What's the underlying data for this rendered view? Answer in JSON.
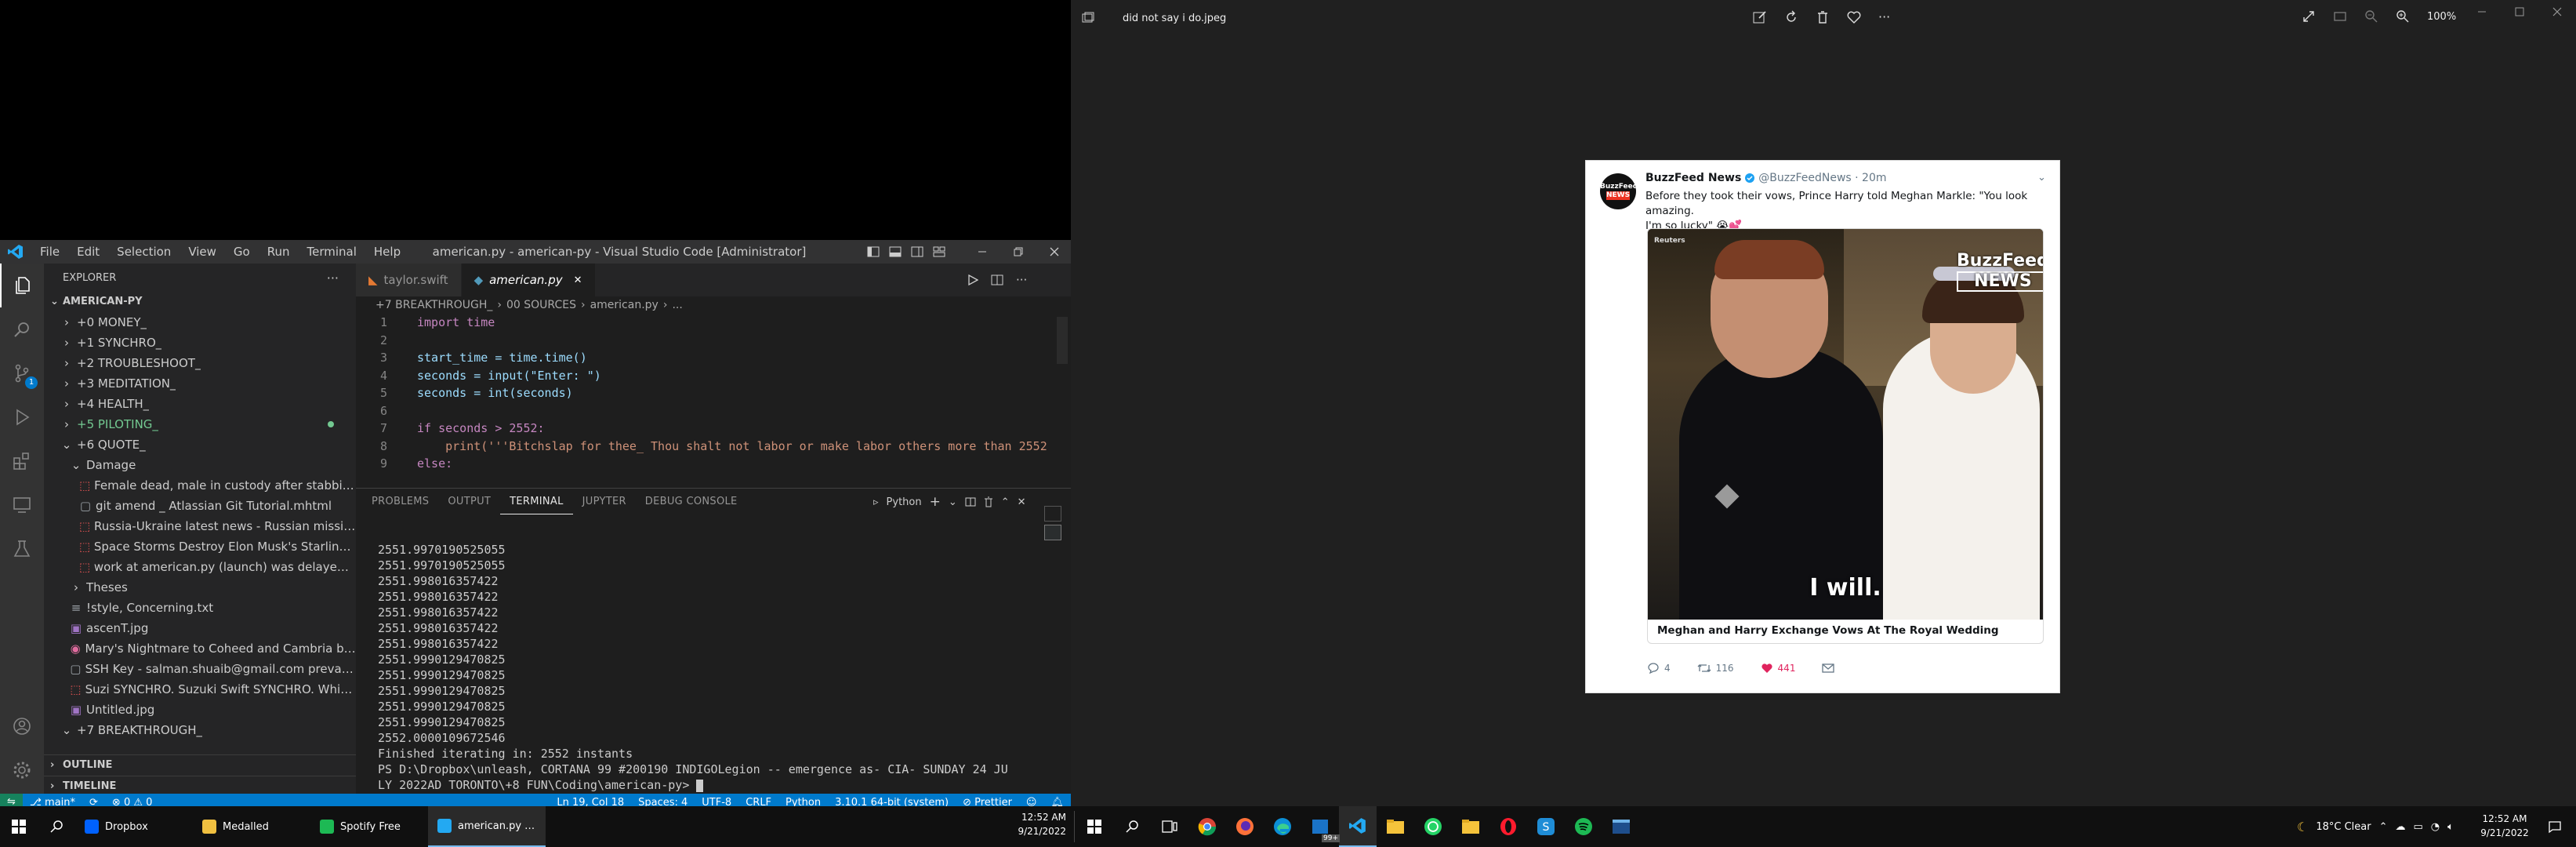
{
  "vscode": {
    "menu": [
      "File",
      "Edit",
      "Selection",
      "View",
      "Go",
      "Run",
      "Terminal",
      "Help"
    ],
    "window_title": "american.py - american-py - Visual Studio Code [Administrator]",
    "explorer_title": "EXPLORER",
    "root": "AMERICAN-PY",
    "tree": [
      {
        "label": "+0 MONEY_",
        "indent": 1,
        "kind": "folder-closed",
        "color": "#cccccc"
      },
      {
        "label": "+1 SYNCHRO_",
        "indent": 1,
        "kind": "folder-closed",
        "color": "#cccccc"
      },
      {
        "label": "+2 TROUBLESHOOT_",
        "indent": 1,
        "kind": "folder-closed",
        "color": "#cccccc"
      },
      {
        "label": "+3 MEDITATION_",
        "indent": 1,
        "kind": "folder-closed",
        "color": "#cccccc"
      },
      {
        "label": "+4 HEALTH_",
        "indent": 1,
        "kind": "folder-closed",
        "color": "#cccccc"
      },
      {
        "label": "+5 PILOTING_",
        "indent": 1,
        "kind": "folder-closed",
        "color": "#73c991",
        "dot": true
      },
      {
        "label": "+6 QUOTE_",
        "indent": 1,
        "kind": "folder-open",
        "color": "#cccccc"
      },
      {
        "label": "Damage",
        "indent": 2,
        "kind": "folder-open",
        "color": "#cccccc"
      },
      {
        "label": "Female dead, male in custody after stabbing in ...",
        "indent": 3,
        "kind": "pdf",
        "color": "#cccccc"
      },
      {
        "label": "git amend _ Atlassian Git Tutorial.mhtml",
        "indent": 3,
        "kind": "file",
        "color": "#cccccc"
      },
      {
        "label": "Russia-Ukraine latest news - Russian missile stri...",
        "indent": 3,
        "kind": "pdf",
        "color": "#cccccc"
      },
      {
        "label": "Space Storms Destroy Elon Musk's Starlink Satel...",
        "indent": 3,
        "kind": "pdf",
        "color": "#cccccc"
      },
      {
        "label": "work at american.py (launch) was delayed - Fem...",
        "indent": 3,
        "kind": "pdf",
        "color": "#cccccc"
      },
      {
        "label": "Theses",
        "indent": 2,
        "kind": "folder-closed",
        "color": "#cccccc"
      },
      {
        "label": "!style, Concerning.txt",
        "indent": 2,
        "kind": "txt",
        "color": "#cccccc"
      },
      {
        "label": "ascenT.jpg",
        "indent": 2,
        "kind": "img",
        "color": "#cccccc"
      },
      {
        "label": "Mary's Nightmare to Coheed and Cambria  by SA...",
        "indent": 2,
        "kind": "media",
        "color": "#cccccc"
      },
      {
        "label": "SSH Key - salman.shuaib@gmail.com  prevail  Pw...",
        "indent": 2,
        "kind": "file",
        "color": "#cccccc"
      },
      {
        "label": "Suzi SYNCHRO. Suzuki Swift SYNCHRO. White SY...",
        "indent": 2,
        "kind": "pdf",
        "color": "#cccccc"
      },
      {
        "label": "Untitled.jpg",
        "indent": 2,
        "kind": "img",
        "color": "#cccccc"
      },
      {
        "label": "+7 BREAKTHROUGH_",
        "indent": 1,
        "kind": "folder-open",
        "color": "#cccccc"
      }
    ],
    "outline": "OUTLINE",
    "timeline": "TIMELINE",
    "tabs": [
      {
        "label": "taylor.swift",
        "active": false
      },
      {
        "label": "american.py",
        "active": true
      }
    ],
    "breadcrumb": [
      "+7 BREAKTHROUGH_",
      "00 SOURCES",
      "american.py",
      "..."
    ],
    "code": [
      {
        "n": "1",
        "t": "import time"
      },
      {
        "n": "2",
        "t": ""
      },
      {
        "n": "3",
        "t": "start_time = time.time()"
      },
      {
        "n": "4",
        "t": "seconds = input(\"Enter: \")"
      },
      {
        "n": "5",
        "t": "seconds = int(seconds)"
      },
      {
        "n": "6",
        "t": ""
      },
      {
        "n": "7",
        "t": "if seconds > 2552:"
      },
      {
        "n": "8",
        "t": "    print('''Bitchslap for thee_ Thou shalt not labor or make labor others more than 2552"
      },
      {
        "n": "9",
        "t": "else:"
      }
    ],
    "panel_tabs": [
      "PROBLEMS",
      "OUTPUT",
      "TERMINAL",
      "JUPYTER",
      "DEBUG CONSOLE"
    ],
    "panel_active": "TERMINAL",
    "terminal_kind": "Python",
    "terminal": [
      "2551.9970190525055",
      "2551.9970190525055",
      "2551.998016357422",
      "2551.998016357422",
      "2551.998016357422",
      "2551.998016357422",
      "2551.998016357422",
      "2551.9990129470825",
      "2551.9990129470825",
      "2551.9990129470825",
      "2551.9990129470825",
      "2551.9990129470825",
      "2552.0000109672546",
      "Finished iterating in: 2552 instants",
      "PS D:\\Dropbox\\unleash, CORTANA 99 #200190 INDIGOLegion -- emergence as- CIA- SUNDAY 24 JU",
      "LY 2022AD TORONTO\\+8 FUN\\Coding\\american-py> "
    ],
    "status": {
      "branch": "main*",
      "errors": "0",
      "warnings": "0",
      "position": "Ln 19, Col 18",
      "spaces": "Spaces: 4",
      "encoding": "UTF-8",
      "eol": "CRLF",
      "language": "Python",
      "interpreter": "3.10.1 64-bit (system)",
      "formatter": "Prettier"
    }
  },
  "photos": {
    "filename": "did not say i do.jpeg",
    "zoom": "100%",
    "tweet": {
      "account": "BuzzFeed News",
      "handle": "@BuzzFeedNews · 20m",
      "text_1": "Before they took their vows, Prince Harry told Meghan Markle: \"You look amazing.",
      "text_2": "I'm so lucky\" 😭💕",
      "avatar_line1": "BuzzFeed",
      "avatar_line2": "NEWS",
      "watermark_1": "BuzzFeed",
      "watermark_2": "NEWS",
      "source": "Reuters",
      "caption": "I will.",
      "card_title": "Meghan and Harry Exchange Vows At The Royal Wedding",
      "replies": "4",
      "retweets": "116",
      "likes": "441"
    }
  },
  "taskbar": {
    "left_apps": [
      {
        "label": "Dropbox",
        "color": "#0061fe"
      },
      {
        "label": "Medalled",
        "color": "#f0c040"
      },
      {
        "label": "Spotify Free",
        "color": "#1db954"
      },
      {
        "label": "american.py - amer...",
        "color": "#23a9f2",
        "active": true
      }
    ],
    "left_time": "12:52 AM",
    "left_date": "9/21/2022",
    "weather": "18°C  Clear",
    "right_time": "12:52 AM",
    "right_date": "9/21/2022"
  }
}
